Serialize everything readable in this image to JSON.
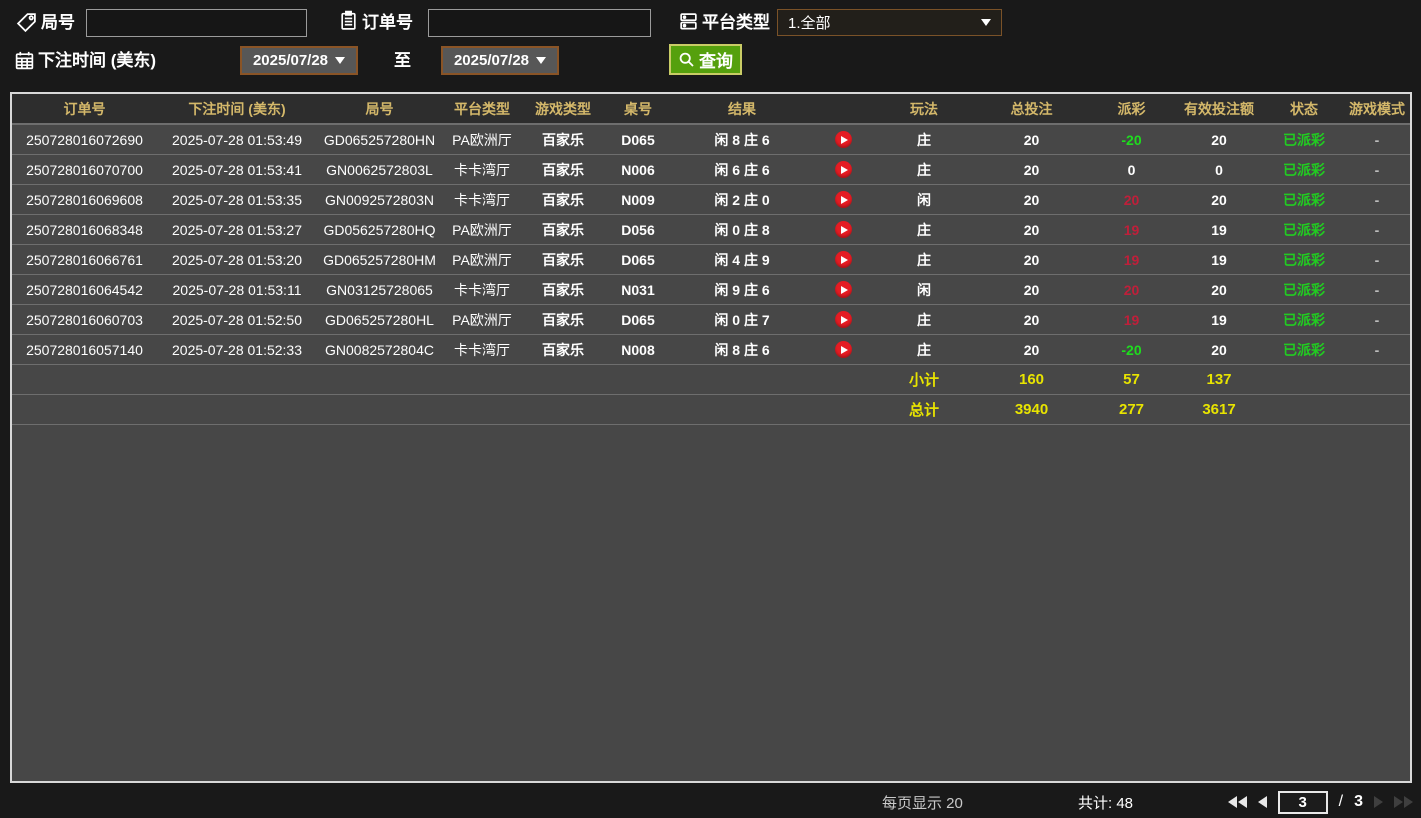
{
  "filters": {
    "game_no": {
      "label": "局号",
      "value": ""
    },
    "order_no": {
      "label": "订单号",
      "value": ""
    },
    "platform": {
      "label": "平台类型",
      "value": "1.全部"
    },
    "bet_time": {
      "label": "下注时间 (美东)",
      "from": "2025/07/28",
      "to_label": "至",
      "to": "2025/07/28"
    },
    "query_label": "查询"
  },
  "table": {
    "headers": [
      "订单号",
      "下注时间 (美东)",
      "局号",
      "平台类型",
      "游戏类型",
      "桌号",
      "结果",
      "",
      "玩法",
      "总投注",
      "派彩",
      "有效投注额",
      "状态",
      "游戏模式"
    ],
    "rows": [
      {
        "order_no": "250728016072690",
        "bet_time": "2025-07-28 01:53:49",
        "game_no": "GD065257280HN",
        "platform": "PA欧洲厅",
        "game_type": "百家乐",
        "table_no": "D065",
        "result": "闲 8 庄 6",
        "play_type": "庄",
        "total_bet": "20",
        "payout": "-20",
        "payout_color": "green",
        "valid_bet": "20",
        "status": "已派彩",
        "mode": "-"
      },
      {
        "order_no": "250728016070700",
        "bet_time": "2025-07-28 01:53:41",
        "game_no": "GN0062572803L",
        "platform": "卡卡湾厅",
        "game_type": "百家乐",
        "table_no": "N006",
        "result": "闲 6 庄 6",
        "play_type": "庄",
        "total_bet": "20",
        "payout": "0",
        "payout_color": "white",
        "valid_bet": "0",
        "status": "已派彩",
        "mode": "-"
      },
      {
        "order_no": "250728016069608",
        "bet_time": "2025-07-28 01:53:35",
        "game_no": "GN0092572803N",
        "platform": "卡卡湾厅",
        "game_type": "百家乐",
        "table_no": "N009",
        "result": "闲 2 庄 0",
        "play_type": "闲",
        "total_bet": "20",
        "payout": "20",
        "payout_color": "red",
        "valid_bet": "20",
        "status": "已派彩",
        "mode": "-"
      },
      {
        "order_no": "250728016068348",
        "bet_time": "2025-07-28 01:53:27",
        "game_no": "GD056257280HQ",
        "platform": "PA欧洲厅",
        "game_type": "百家乐",
        "table_no": "D056",
        "result": "闲 0 庄 8",
        "play_type": "庄",
        "total_bet": "20",
        "payout": "19",
        "payout_color": "red",
        "valid_bet": "19",
        "status": "已派彩",
        "mode": "-"
      },
      {
        "order_no": "250728016066761",
        "bet_time": "2025-07-28 01:53:20",
        "game_no": "GD065257280HM",
        "platform": "PA欧洲厅",
        "game_type": "百家乐",
        "table_no": "D065",
        "result": "闲 4 庄 9",
        "play_type": "庄",
        "total_bet": "20",
        "payout": "19",
        "payout_color": "red",
        "valid_bet": "19",
        "status": "已派彩",
        "mode": "-"
      },
      {
        "order_no": "250728016064542",
        "bet_time": "2025-07-28 01:53:11",
        "game_no": "GN03125728065",
        "platform": "卡卡湾厅",
        "game_type": "百家乐",
        "table_no": "N031",
        "result": "闲 9 庄 6",
        "play_type": "闲",
        "total_bet": "20",
        "payout": "20",
        "payout_color": "red",
        "valid_bet": "20",
        "status": "已派彩",
        "mode": "-"
      },
      {
        "order_no": "250728016060703",
        "bet_time": "2025-07-28 01:52:50",
        "game_no": "GD065257280HL",
        "platform": "PA欧洲厅",
        "game_type": "百家乐",
        "table_no": "D065",
        "result": "闲 0 庄 7",
        "play_type": "庄",
        "total_bet": "20",
        "payout": "19",
        "payout_color": "red",
        "valid_bet": "19",
        "status": "已派彩",
        "mode": "-"
      },
      {
        "order_no": "250728016057140",
        "bet_time": "2025-07-28 01:52:33",
        "game_no": "GN0082572804C",
        "platform": "卡卡湾厅",
        "game_type": "百家乐",
        "table_no": "N008",
        "result": "闲 8 庄 6",
        "play_type": "庄",
        "total_bet": "20",
        "payout": "-20",
        "payout_color": "green",
        "valid_bet": "20",
        "status": "已派彩",
        "mode": "-"
      }
    ],
    "subtotal": {
      "label": "小计",
      "total_bet": "160",
      "payout": "57",
      "valid_bet": "137"
    },
    "total": {
      "label": "总计",
      "total_bet": "3940",
      "payout": "277",
      "valid_bet": "3617"
    }
  },
  "pagination": {
    "per_page_label": "每页显示 20",
    "total_count_label": "共计: 48",
    "current_page": "3",
    "page_separator": "/",
    "total_pages": "3"
  },
  "colors": {
    "payout_positive_red": "#c01f3a",
    "payout_negative_green": "#1edc1e",
    "status_green": "#21cc21",
    "totals_yellow": "#e8e400",
    "header_gold": "#d4b86a",
    "query_button_green": "#55a00d",
    "date_button_border": "#8a5426",
    "table_background": "#474747"
  }
}
